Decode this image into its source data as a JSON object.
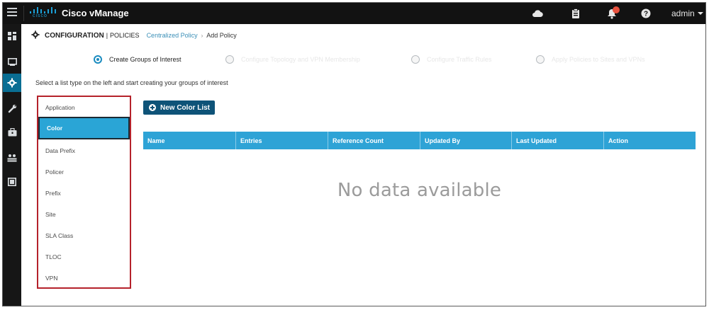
{
  "app": {
    "brand_word": "cisco",
    "title": "Cisco vManage",
    "user": "admin"
  },
  "topbar": {
    "icons": [
      "cloud-icon",
      "clipboard-icon",
      "bell-icon",
      "help-icon"
    ],
    "notification_color": "#e8523f"
  },
  "leftnav": {
    "items": [
      "dashboard-icon",
      "monitor-icon",
      "configuration-icon",
      "tools-icon",
      "maintenance-icon",
      "administration-icon",
      "analytics-icon"
    ],
    "active_index": 2,
    "active_color": "#0a6e93"
  },
  "breadcrumb": {
    "section": "CONFIGURATION",
    "separator": "|",
    "subsection": "POLICIES",
    "link": "Centralized Policy",
    "arrow": "›",
    "current": "Add Policy"
  },
  "steps": [
    {
      "label": "Create Groups of Interest",
      "active": true
    },
    {
      "label": "Configure Topology and VPN Membership",
      "active": false
    },
    {
      "label": "Configure Traffic Rules",
      "active": false
    },
    {
      "label": "Apply Policies to Sites and VPNs",
      "active": false
    }
  ],
  "instructions": "Select a list type on the left and start creating your groups of interest",
  "list_types": {
    "items": [
      "Application",
      "Color",
      "Data Prefix",
      "Policer",
      "Prefix",
      "Site",
      "SLA Class",
      "TLOC",
      "VPN"
    ],
    "selected": "Color",
    "highlight_color": "#b5222b"
  },
  "actions": {
    "new_button": "New Color List"
  },
  "table": {
    "columns": [
      "Name",
      "Entries",
      "Reference Count",
      "Updated By",
      "Last Updated",
      "Action"
    ],
    "header_color": "#2ea3d6",
    "empty_message": "No data available"
  }
}
